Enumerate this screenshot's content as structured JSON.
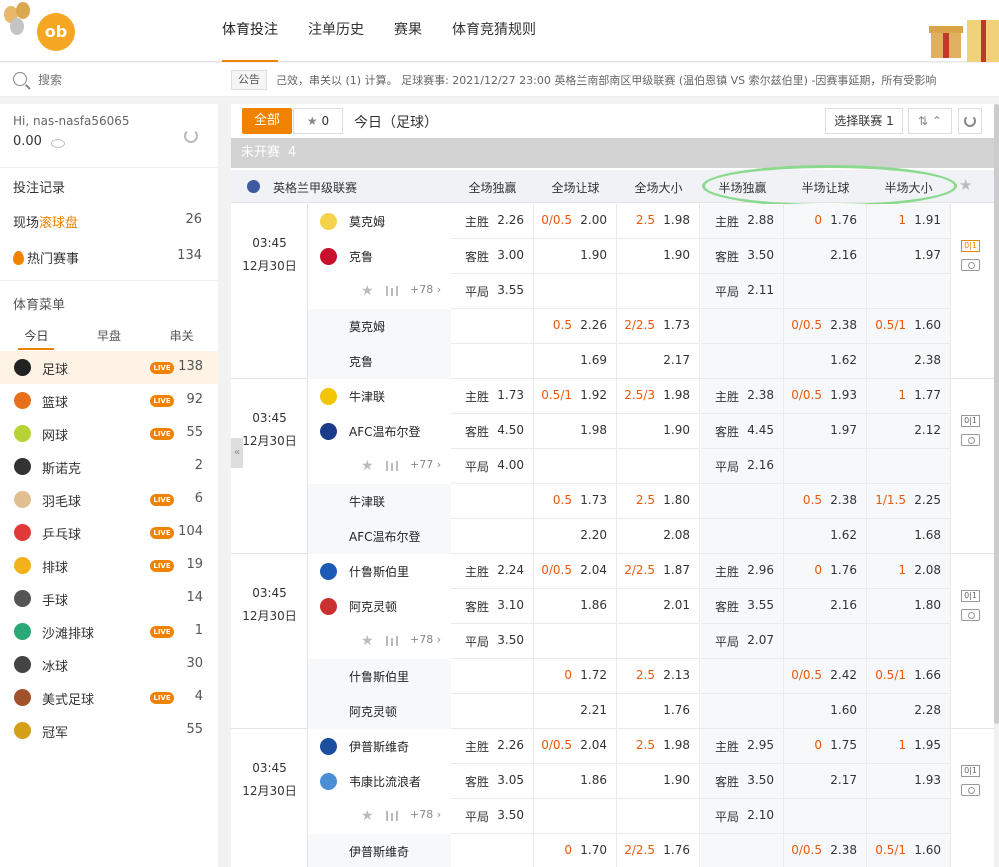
{
  "nav": {
    "items": [
      "体育投注",
      "注单历史",
      "赛果",
      "体育竞猜规则"
    ],
    "active": 0
  },
  "search": {
    "placeholder": "搜索"
  },
  "notice": {
    "tag": "公告",
    "text": "己效，串关以 (1) 计算。    足球赛事: 2021/12/27 23:00 英格兰南部南区甲级联赛 (温伯恩镇 VS 索尔兹伯里) -因赛事延期，所有受影响"
  },
  "user": {
    "greeting": "Hi, nas-nasfa56065",
    "balance": "0.00"
  },
  "sidebar": {
    "bet_record": "投注记录",
    "live_prefix": "现场",
    "live_highlight": "滚球盘",
    "live_count": "26",
    "hot_label": "热门赛事",
    "hot_count": "134",
    "menu_title": "体育菜单",
    "tabs": [
      "今日",
      "早盘",
      "串关"
    ],
    "sports": [
      {
        "label": "足球",
        "live": true,
        "count": "138",
        "color": "#222"
      },
      {
        "label": "篮球",
        "live": true,
        "count": "92",
        "color": "#e8701a"
      },
      {
        "label": "网球",
        "live": true,
        "count": "55",
        "color": "#b5d334"
      },
      {
        "label": "斯诺克",
        "live": false,
        "count": "2",
        "color": "#333"
      },
      {
        "label": "羽毛球",
        "live": true,
        "count": "6",
        "color": "#e0c090"
      },
      {
        "label": "乒乓球",
        "live": true,
        "count": "104",
        "color": "#e03a3a"
      },
      {
        "label": "排球",
        "live": true,
        "count": "19",
        "color": "#f2b21c"
      },
      {
        "label": "手球",
        "live": false,
        "count": "14",
        "color": "#555"
      },
      {
        "label": "沙滩排球",
        "live": true,
        "count": "1",
        "color": "#2aa876"
      },
      {
        "label": "冰球",
        "live": false,
        "count": "30",
        "color": "#444"
      },
      {
        "label": "美式足球",
        "live": true,
        "count": "4",
        "color": "#a0522d"
      },
      {
        "label": "冠军",
        "live": false,
        "count": "55",
        "color": "#d4a017"
      }
    ],
    "live_badge": "LIVE"
  },
  "main": {
    "btn_all": "全部",
    "fav_count": "0",
    "today_label": "今日（足球）",
    "btn_league": "选择联赛 1",
    "section_title": "未开赛",
    "section_count": "4",
    "league_name": "英格兰甲级联赛",
    "columns": [
      "全场独赢",
      "全场让球",
      "全场大小",
      "半场独赢",
      "半场让球",
      "半场大小"
    ]
  },
  "matches": [
    {
      "time": "03:45",
      "date": "12月30日",
      "home": "莫克姆",
      "away": "克鲁",
      "more": "+78",
      "home_color": "#f5d24a",
      "away_color": "#c8102e",
      "live_scoreboard": true,
      "rows": [
        [
          "主胜",
          "2.26",
          "0/0.5",
          "2.00",
          "2.5",
          "1.98",
          "主胜",
          "2.88",
          "0",
          "1.76",
          "1",
          "1.91"
        ],
        [
          "客胜",
          "3.00",
          "",
          "1.90",
          "",
          "1.90",
          "客胜",
          "3.50",
          "",
          "2.16",
          "",
          "1.97"
        ],
        [
          "平局",
          "3.55",
          "",
          "",
          "",
          "",
          "平局",
          "2.11",
          "",
          "",
          "",
          ""
        ],
        [
          "",
          "",
          "0.5",
          "2.26",
          "2/2.5",
          "1.73",
          "",
          "",
          "0/0.5",
          "2.38",
          "0.5/1",
          "1.60"
        ],
        [
          "",
          "",
          "",
          "1.69",
          "",
          "2.17",
          "",
          "",
          "",
          "1.62",
          "",
          "2.38"
        ]
      ]
    },
    {
      "time": "03:45",
      "date": "12月30日",
      "home": "牛津联",
      "away": "AFC温布尔登",
      "more": "+77",
      "home_color": "#f2c500",
      "away_color": "#1a3a8a",
      "live_scoreboard": false,
      "rows": [
        [
          "主胜",
          "1.73",
          "0.5/1",
          "1.92",
          "2.5/3",
          "1.98",
          "主胜",
          "2.38",
          "0/0.5",
          "1.93",
          "1",
          "1.77"
        ],
        [
          "客胜",
          "4.50",
          "",
          "1.98",
          "",
          "1.90",
          "客胜",
          "4.45",
          "",
          "1.97",
          "",
          "2.12"
        ],
        [
          "平局",
          "4.00",
          "",
          "",
          "",
          "",
          "平局",
          "2.16",
          "",
          "",
          "",
          ""
        ],
        [
          "",
          "",
          "0.5",
          "1.73",
          "2.5",
          "1.80",
          "",
          "",
          "0.5",
          "2.38",
          "1/1.5",
          "2.25"
        ],
        [
          "",
          "",
          "",
          "2.20",
          "",
          "2.08",
          "",
          "",
          "",
          "1.62",
          "",
          "1.68"
        ]
      ]
    },
    {
      "time": "03:45",
      "date": "12月30日",
      "home": "什鲁斯伯里",
      "away": "阿克灵顿",
      "more": "+78",
      "home_color": "#1c5bb5",
      "away_color": "#c8312e",
      "live_scoreboard": false,
      "rows": [
        [
          "主胜",
          "2.24",
          "0/0.5",
          "2.04",
          "2/2.5",
          "1.87",
          "主胜",
          "2.96",
          "0",
          "1.76",
          "1",
          "2.08"
        ],
        [
          "客胜",
          "3.10",
          "",
          "1.86",
          "",
          "2.01",
          "客胜",
          "3.55",
          "",
          "2.16",
          "",
          "1.80"
        ],
        [
          "平局",
          "3.50",
          "",
          "",
          "",
          "",
          "平局",
          "2.07",
          "",
          "",
          "",
          ""
        ],
        [
          "",
          "",
          "0",
          "1.72",
          "2.5",
          "2.13",
          "",
          "",
          "0/0.5",
          "2.42",
          "0.5/1",
          "1.66"
        ],
        [
          "",
          "",
          "",
          "2.21",
          "",
          "1.76",
          "",
          "",
          "",
          "1.60",
          "",
          "2.28"
        ]
      ]
    },
    {
      "time": "03:45",
      "date": "12月30日",
      "home": "伊普斯维奇",
      "away": "韦康比流浪者",
      "more": "+78",
      "home_color": "#1c4ea0",
      "away_color": "#4a8fd6",
      "live_scoreboard": false,
      "rows": [
        [
          "主胜",
          "2.26",
          "0/0.5",
          "2.04",
          "2.5",
          "1.98",
          "主胜",
          "2.95",
          "0",
          "1.75",
          "1",
          "1.95"
        ],
        [
          "客胜",
          "3.05",
          "",
          "1.86",
          "",
          "1.90",
          "客胜",
          "3.50",
          "",
          "2.17",
          "",
          "1.93"
        ],
        [
          "平局",
          "3.50",
          "",
          "",
          "",
          "",
          "平局",
          "2.10",
          "",
          "",
          "",
          ""
        ],
        [
          "",
          "",
          "0",
          "1.70",
          "2/2.5",
          "1.76",
          "",
          "",
          "0/0.5",
          "2.38",
          "0.5/1",
          "1.60"
        ],
        [
          "",
          "",
          "",
          "",
          "",
          "",
          "",
          "",
          "",
          "",
          "",
          ""
        ]
      ]
    }
  ],
  "colors": {
    "accent": "#f08200",
    "handicap": "#e8590c",
    "highlight": "#8bd98f"
  }
}
